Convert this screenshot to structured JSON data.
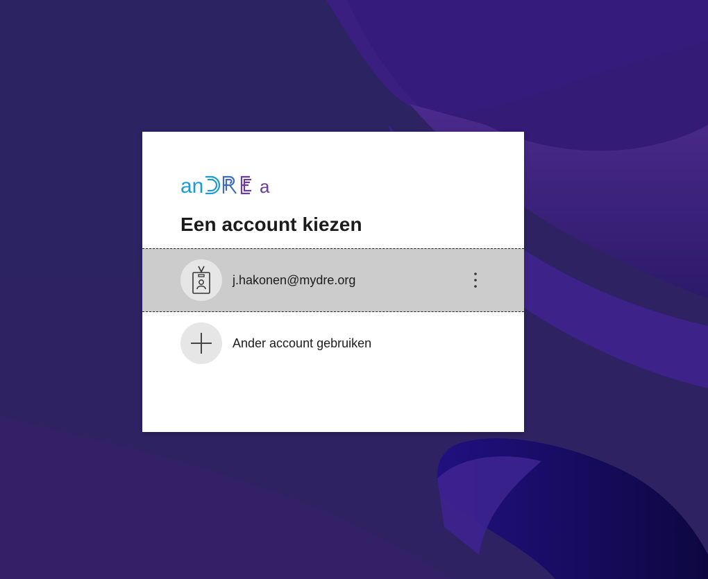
{
  "brand": {
    "logo_text": "anDREa",
    "colors": {
      "primary": "#1a9ad6",
      "secondary": "#6a3d97"
    }
  },
  "dialog": {
    "title": "Een account kiezen"
  },
  "accounts": [
    {
      "email": "j.hakonen@mydre.org",
      "icon": "badge-icon",
      "selected": true,
      "menu_icon": "more-options-icon"
    }
  ],
  "other_account": {
    "label": "Ander account gebruiken",
    "icon": "plus-icon"
  },
  "theme": {
    "background": "#2f2163",
    "card": "#ffffff",
    "selected_tile": "#cccccc"
  }
}
